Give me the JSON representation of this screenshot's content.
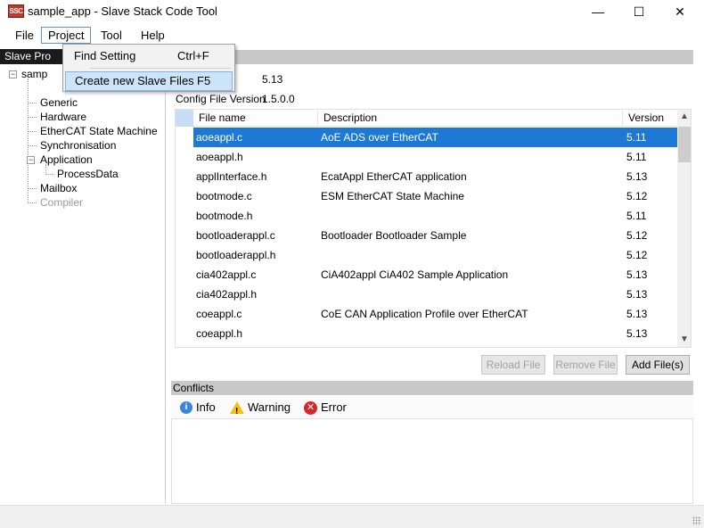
{
  "window": {
    "title": "sample_app - Slave Stack Code Tool",
    "icon_text": "SSC",
    "minimize": "—",
    "maximize": "☐",
    "close": "✕"
  },
  "menu": {
    "file": "File",
    "project": "Project",
    "tool": "Tool",
    "help": "Help"
  },
  "dropdown": {
    "items": [
      {
        "label": "Find Setting",
        "shortcut": "Ctrl+F"
      },
      {
        "label": "Create new Slave Files",
        "shortcut": "F5"
      }
    ]
  },
  "left_panel": {
    "header": "Slave Pro",
    "root": "samp",
    "items": [
      "Generic",
      "Hardware",
      "EtherCAT State Machine",
      "Synchronisation",
      "Application",
      "ProcessData",
      "Mailbox",
      "Compiler"
    ],
    "expand_symbol": "−"
  },
  "info": {
    "version_value": "5.13",
    "config_label": "Config File Version",
    "config_value": "1.5.0.0"
  },
  "table": {
    "columns": [
      "File name",
      "Description",
      "Version"
    ],
    "rows": [
      {
        "file": "aoeappl.c",
        "desc": "AoE ADS over EtherCAT",
        "ver": "5.11"
      },
      {
        "file": "aoeappl.h",
        "desc": "",
        "ver": "5.11"
      },
      {
        "file": "applInterface.h",
        "desc": "EcatAppl EtherCAT application",
        "ver": "5.13"
      },
      {
        "file": "bootmode.c",
        "desc": "ESM EtherCAT State Machine",
        "ver": "5.12"
      },
      {
        "file": "bootmode.h",
        "desc": "",
        "ver": "5.11"
      },
      {
        "file": "bootloaderappl.c",
        "desc": "Bootloader Bootloader Sample",
        "ver": "5.12"
      },
      {
        "file": "bootloaderappl.h",
        "desc": "",
        "ver": "5.12"
      },
      {
        "file": "cia402appl.c",
        "desc": "CiA402appl CiA402 Sample Application",
        "ver": "5.13"
      },
      {
        "file": "cia402appl.h",
        "desc": "",
        "ver": "5.13"
      },
      {
        "file": "coeappl.c",
        "desc": "CoE CAN Application Profile over EtherCAT",
        "ver": "5.13"
      },
      {
        "file": "coeappl.h",
        "desc": "",
        "ver": "5.13"
      }
    ],
    "scroll_up": "▲",
    "scroll_down": "▼"
  },
  "buttons": {
    "reload": "Reload File",
    "remove": "Remove File",
    "add": "Add File(s)"
  },
  "conflicts": {
    "title": "Conflicts",
    "info": "Info",
    "warning": "Warning",
    "error": "Error",
    "info_glyph": "i",
    "warn_glyph": "!",
    "err_glyph": "✕"
  }
}
